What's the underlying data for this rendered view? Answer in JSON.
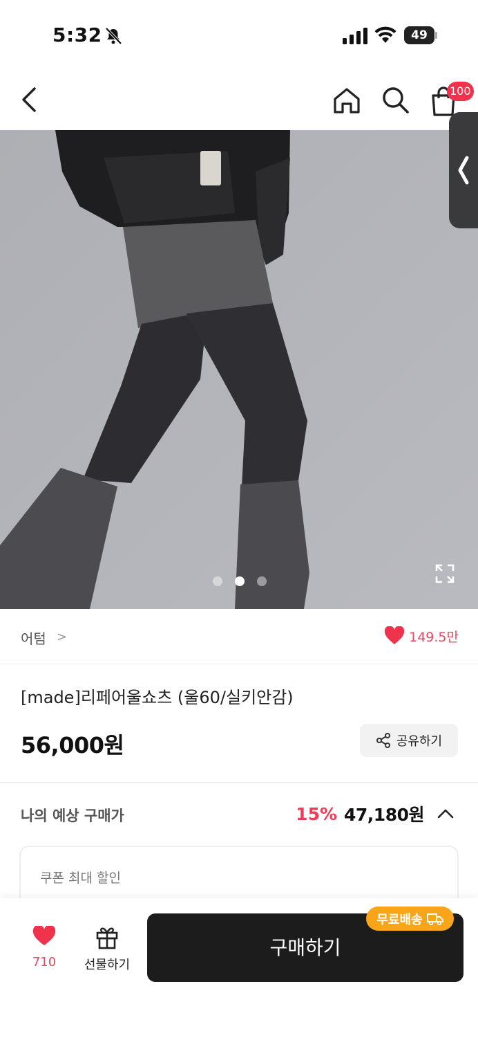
{
  "status_bar": {
    "time": "5:32",
    "battery": "49"
  },
  "header": {
    "cart_count": "100"
  },
  "gallery": {
    "dot_count": 3,
    "active_index": 1
  },
  "brand": {
    "name": "어텀",
    "chevron": ">",
    "likes": "149.5만"
  },
  "product": {
    "title": "[made]리페어울쇼츠 (울60/실키안감)",
    "price": "56,000원",
    "share_label": "공유하기"
  },
  "expected": {
    "label": "나의 예상 구매가",
    "discount": "15%",
    "price": "47,180원"
  },
  "coupon": {
    "label": "쿠폰 최대 할인"
  },
  "bottom": {
    "wish_count": "710",
    "gift_label": "선물하기",
    "buy_label": "구매하기",
    "free_ship_label": "무료배송"
  },
  "colors": {
    "accent_red": "#ef3c57",
    "heart": "#f0334d",
    "free_ship": "#f9a51a",
    "buy_bg": "#1c1c1c"
  }
}
